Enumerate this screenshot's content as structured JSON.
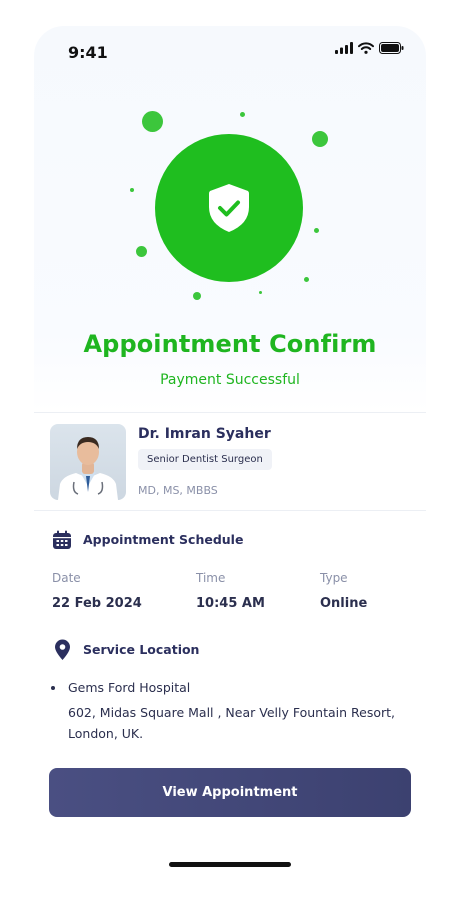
{
  "status_bar": {
    "time": "9:41"
  },
  "confirmation": {
    "title": "Appointment Confirm",
    "subtitle": "Payment Successful"
  },
  "doctor": {
    "name": "Dr. Imran Syaher",
    "specialty": "Senior Dentist Surgeon",
    "degrees": "MD, MS, MBBS"
  },
  "schedule": {
    "section_title": "Appointment Schedule",
    "date_label": "Date",
    "date_value": "22 Feb 2024",
    "time_label": "Time",
    "time_value": "10:45 AM",
    "type_label": "Type",
    "type_value": "Online"
  },
  "location": {
    "section_title": "Service Location",
    "name": "Gems Ford Hospital",
    "address": "602, Midas Square Mall , Near Velly Fountain Resort, London, UK."
  },
  "actions": {
    "view_appointment": "View Appointment"
  },
  "colors": {
    "success_green": "#1fbe1f",
    "primary_navy": "#3c4170",
    "text_dark": "#2b2f4e",
    "text_muted": "#8a90a8"
  }
}
